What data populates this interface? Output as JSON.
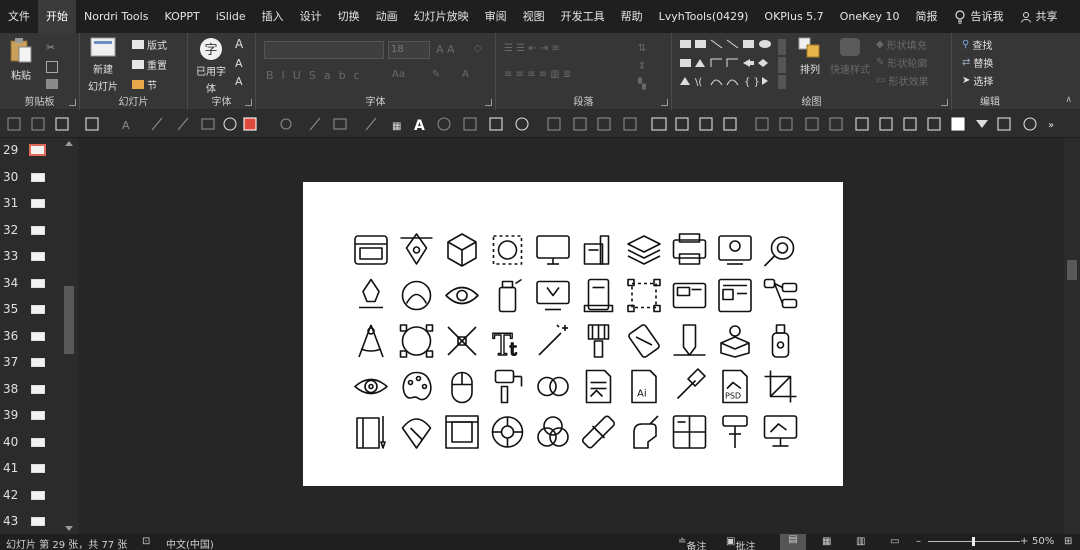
{
  "tabs": [
    "文件",
    "开始",
    "Nordri Tools",
    "KOPPT",
    "iSlide",
    "插入",
    "设计",
    "切换",
    "动画",
    "幻灯片放映",
    "审阅",
    "视图",
    "开发工具",
    "帮助",
    "LvyhTools(0429)",
    "OKPlus 5.7",
    "OneKey 10",
    "简报"
  ],
  "active_tab": "开始",
  "tellme": "告诉我",
  "share": "共享",
  "ribbon": {
    "clipboard": {
      "paste": "粘贴",
      "label": "剪贴板"
    },
    "slides": {
      "new_slide": "新建",
      "new_slide2": "幻灯片",
      "layout": "版式",
      "reset": "重置",
      "section": "节",
      "label": "幻灯片"
    },
    "font_group": {
      "used_font": "已用字",
      "used_font2": "体",
      "label": "字体"
    },
    "font": {
      "size": "18",
      "label": "字体"
    },
    "paragraph": {
      "label": "段落"
    },
    "drawing": {
      "arrange": "排列",
      "quick_styles": "快速样式",
      "shape_fill": "形状填充",
      "shape_outline": "形状轮廓",
      "shape_effects": "形状效果",
      "label": "绘图"
    },
    "editing": {
      "find": "查找",
      "replace": "替换",
      "select": "选择",
      "label": "编辑"
    }
  },
  "slides": [
    {
      "num": "29",
      "selected": true
    },
    {
      "num": "30"
    },
    {
      "num": "31"
    },
    {
      "num": "32"
    },
    {
      "num": "33"
    },
    {
      "num": "34"
    },
    {
      "num": "35"
    },
    {
      "num": "36"
    },
    {
      "num": "37"
    },
    {
      "num": "38"
    },
    {
      "num": "39"
    },
    {
      "num": "40"
    },
    {
      "num": "41"
    },
    {
      "num": "42"
    },
    {
      "num": "43"
    }
  ],
  "status": {
    "slide_info": "幻灯片 第 29 张，共 77 张",
    "language": "中文(中国)",
    "notes": "备注",
    "comments": "批注",
    "zoom": "50%"
  }
}
